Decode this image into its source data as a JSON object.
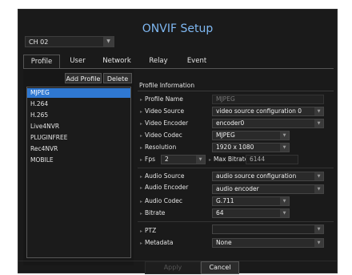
{
  "title": "ONVIF Setup",
  "channel": "CH 02",
  "tabs": [
    "Profile",
    "User",
    "Network",
    "Relay",
    "Event"
  ],
  "buttons": {
    "add_profile": "Add Profile",
    "delete": "Delete",
    "apply": "Apply",
    "cancel": "Cancel"
  },
  "profiles": [
    "MJPEG",
    "H.264",
    "H.265",
    "Live4NVR",
    "PLUGINFREE",
    "Rec4NVR",
    "MOBILE"
  ],
  "selected_profile": "MJPEG",
  "info": {
    "heading": "Profile Information",
    "profile_name_label": "Profile Name",
    "profile_name_value": "MJPEG",
    "video_source_label": "Video Source",
    "video_source_value": "video source configuration 0",
    "video_encoder_label": "Video Encoder",
    "video_encoder_value": "encoder0",
    "video_codec_label": "Video Codec",
    "video_codec_value": "MJPEG",
    "resolution_label": "Resolution",
    "resolution_value": "1920 x 1080",
    "fps_label": "Fps",
    "fps_value": "2",
    "max_bitrate_label": "Max Bitrate",
    "max_bitrate_value": "6144",
    "audio_source_label": "Audio Source",
    "audio_source_value": "audio source configuration",
    "audio_encoder_label": "Audio Encoder",
    "audio_encoder_value": "audio encoder",
    "audio_codec_label": "Audio Codec",
    "audio_codec_value": "G.711",
    "bitrate_label": "Bitrate",
    "bitrate_value": "64",
    "ptz_label": "PTZ",
    "ptz_value": "",
    "metadata_label": "Metadata",
    "metadata_value": "None"
  },
  "colors": {
    "accent": "#2f78d2",
    "title": "#7fb8f2",
    "background": "#1a1a1a"
  }
}
